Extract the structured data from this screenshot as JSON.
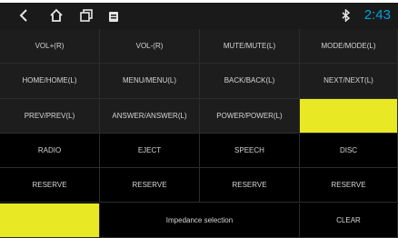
{
  "status_bar": {
    "time": "2:43",
    "icons": [
      "back-arrow-icon",
      "home-icon",
      "recent-apps-icon",
      "notification-icon",
      "bluetooth-icon"
    ]
  },
  "colors": {
    "accent_time": "#00a0e0",
    "highlight": "#e8e824",
    "cell_gray": "#1d1d1d",
    "cell_black": "#000000"
  },
  "rows": [
    [
      {
        "label": "VOL+(R)"
      },
      {
        "label": "VOL-(R)"
      },
      {
        "label": "MUTE/MUTE(L)"
      },
      {
        "label": "MODE/MODE(L)"
      }
    ],
    [
      {
        "label": "HOME/HOME(L)"
      },
      {
        "label": "MENU/MENU(L)"
      },
      {
        "label": "BACK/BACK(L)"
      },
      {
        "label": "NEXT/NEXT(L)"
      }
    ],
    [
      {
        "label": "PREV/PREV(L)"
      },
      {
        "label": "ANSWER/ANSWER(L)"
      },
      {
        "label": "POWER/POWER(L)"
      },
      {
        "label": "",
        "highlighted": true
      }
    ],
    [
      {
        "label": "RADIO"
      },
      {
        "label": "EJECT"
      },
      {
        "label": "SPEECH"
      },
      {
        "label": "DISC"
      }
    ],
    [
      {
        "label": "RESERVE"
      },
      {
        "label": "RESERVE"
      },
      {
        "label": "RESERVE"
      },
      {
        "label": "RESERVE"
      }
    ],
    [
      {
        "label": "",
        "highlighted": true
      },
      {
        "label": "Impedance selection",
        "span": 2
      },
      {
        "label": "CLEAR"
      }
    ]
  ]
}
